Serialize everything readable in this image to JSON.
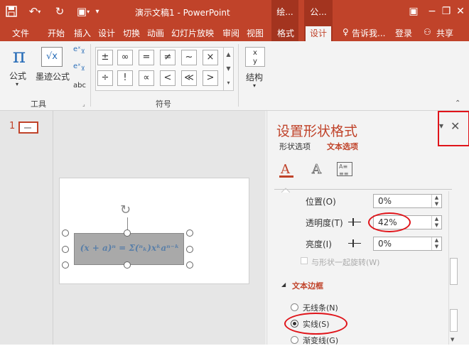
{
  "titlebar": {
    "window_title": "演示文稿1 - PowerPoint",
    "ctx_tab1": "绘...",
    "ctx_tab2": "公..."
  },
  "tabs": [
    "文件",
    "开始",
    "插入",
    "设计",
    "切换",
    "动画",
    "幻灯片放映",
    "审阅",
    "视图",
    "格式",
    "设计"
  ],
  "tell_me": "告诉我...",
  "login": "登录",
  "share": "共享",
  "ribbon": {
    "formula_label": "公式",
    "ink_label": "墨迹公式",
    "tools_group": "工具",
    "symbols_group": "符号",
    "structure_label": "结构",
    "symbols_row1": [
      "±",
      "∞",
      "=",
      "≠",
      "~",
      "×"
    ],
    "symbols_row2": [
      "÷",
      "!",
      "∝",
      "<",
      "≪",
      ">"
    ]
  },
  "slides": {
    "number": "1"
  },
  "equation_text": "(x + a)ⁿ = Σ(ⁿₖ)xᵏaⁿ⁻ᵏ",
  "pane": {
    "title": "设置形状格式",
    "tab_shape": "形状选项",
    "tab_text": "文本选项",
    "position_label": "位置(O)",
    "position_value": "0%",
    "transparency_label": "透明度(T)",
    "transparency_value": "42%",
    "brightness_label": "亮度(I)",
    "brightness_value": "0%",
    "rotate_label": "与形状一起旋转(W)",
    "section_title": "文本边框",
    "no_line": "无线条(N)",
    "solid_line": "实线(S)",
    "gradient_line": "渐变线(G)"
  },
  "colors": {
    "accent": "#c0432a",
    "highlight": "#e0141a"
  }
}
